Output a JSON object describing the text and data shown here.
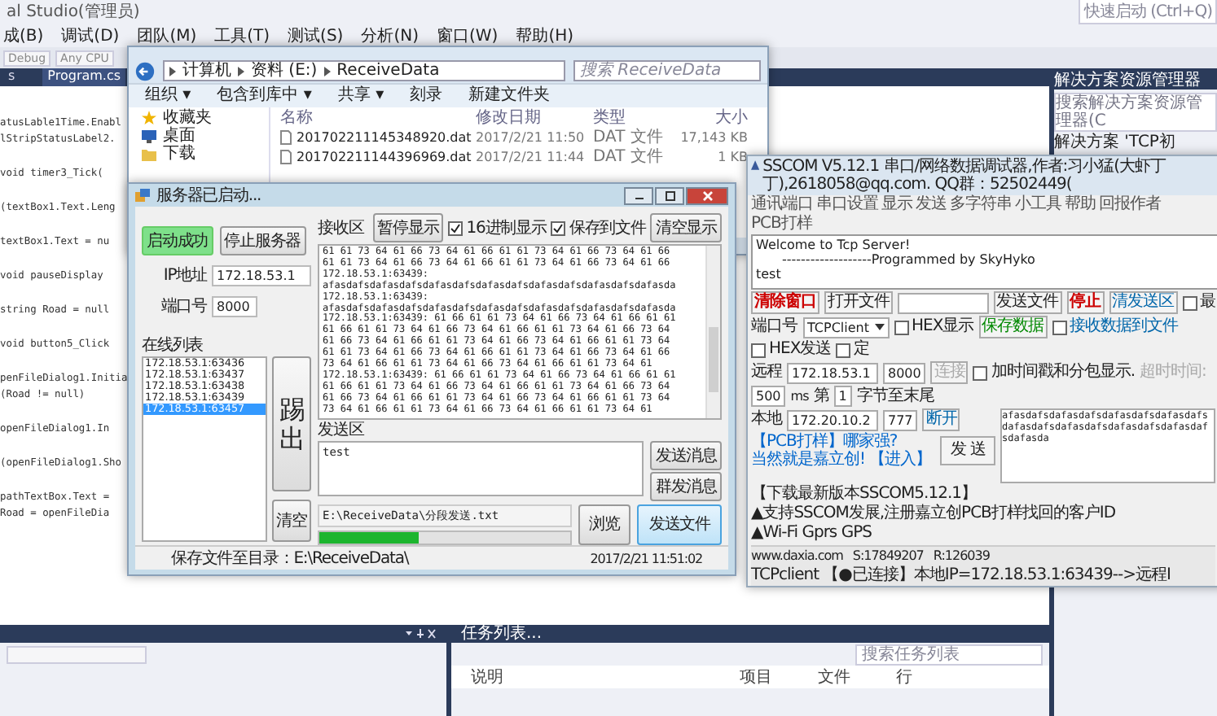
{
  "ide": {
    "title": "al Studio(管理员)",
    "menu": [
      "成(B)",
      "调试(D)",
      "团队(M)",
      "工具(T)",
      "测试(S)",
      "分析(N)",
      "窗口(W)",
      "帮助(H)"
    ],
    "quick_launch": {
      "placeholder": "快速启动 (Ctrl+Q)"
    },
    "toolbar": {
      "configuration": "Debug",
      "platform": "Any CPU"
    },
    "tabs": [
      {
        "label": "s",
        "selected": false
      },
      {
        "label": "Program.cs",
        "selected": true
      }
    ],
    "code_blocks": [
      [
        "atusLable1Time.Enabl",
        "lStripStatusLabel2."
      ],
      [
        "void timer3_Tick("
      ],
      [
        "(textBox1.Text.Leng"
      ],
      [
        "textBox1.Text = nu"
      ],
      [
        "void pauseDisplay"
      ],
      [
        "string Road = null"
      ],
      [
        "void button5_Click"
      ],
      [
        "penFileDialog1.Initia",
        "(Road != null)"
      ],
      [
        "openFileDialog1.In"
      ],
      [
        "(openFileDialog1.Sho"
      ],
      [
        "pathTextBox.Text =",
        "Road = openFileDia"
      ]
    ],
    "solution_explorer": {
      "title": "解决方案资源管理器",
      "search": {
        "placeholder": "搜索解决方案资源管理器(C"
      },
      "items": [
        "解决方案 'TCP初"
      ]
    },
    "task_list": {
      "title": "任务列表...",
      "search": {
        "placeholder": "搜索任务列表"
      },
      "columns": [
        "说明",
        "项目",
        "文件",
        "行"
      ]
    }
  },
  "explorer": {
    "breadcrumb": [
      "计算机",
      "资料 (E:)",
      "ReceiveData"
    ],
    "search": {
      "placeholder": "搜索 ReceiveData"
    },
    "toolbar": [
      "组织 ▾",
      "包含到库中 ▾",
      "共享 ▾",
      "刻录",
      "新建文件夹"
    ],
    "sidebar": [
      {
        "label": "收藏夹",
        "kind": "star"
      },
      {
        "label": "桌面",
        "kind": "desktop"
      },
      {
        "label": "下载",
        "kind": "folder"
      }
    ],
    "columns": [
      "名称",
      "修改日期",
      "类型",
      "大小"
    ],
    "files": [
      {
        "name": "201702211145348920.dat",
        "modified": "2017/2/21 11:50",
        "type": "DAT 文件",
        "size": "17,143 KB"
      },
      {
        "name": "201702211144396969.dat",
        "modified": "2017/2/21 11:44",
        "type": "DAT 文件",
        "size": "1 KB"
      }
    ]
  },
  "server": {
    "title": "服务器已启动...",
    "start_button": "启动成功",
    "stop_button": "停止服务器",
    "ip": {
      "label": "IP地址",
      "value": "172.18.53.1"
    },
    "port": {
      "label": "端口号",
      "value": "8000"
    },
    "online_label": "在线列表",
    "clients": [
      {
        "label": "172.18.53.1:63436",
        "selected": false
      },
      {
        "label": "172.18.53.1:63437",
        "selected": false
      },
      {
        "label": "172.18.53.1:63438",
        "selected": false
      },
      {
        "label": "172.18.53.1:63439",
        "selected": false
      },
      {
        "label": "172.18.53.1:63457",
        "selected": true
      }
    ],
    "kick_button": "踢出",
    "clear_button": "清空",
    "receive_label": "接收区",
    "pause_button": "暂停显示",
    "options": [
      {
        "label": "16进制显示",
        "checked": true
      },
      {
        "label": "保存到文件",
        "checked": true
      }
    ],
    "clear_display_button": "清空显示",
    "received": [
      "61 61 73 64 61 66 73 64 61 66 61 61 73 64 61 66 73 64 61 66",
      "61 61 73 64 61 66 73 64 61 66 61 61 73 64 61 66 73 64 61 66",
      "172.18.53.1:63439:",
      "afasdafsdafasdafsdafasdafsdafasdafsdafasdafsdafasdafsdafasda",
      "172.18.53.1:63439:",
      "afasdafsdafasdafsdafasdafsdafasdafsdafasdafsdafasdafsdafasda",
      "172.18.53.1:63439:  61 66 61 61 73 64 61 66 73 64 61 66 61 61",
      "61 66 61 61 73 64 61 66 73 64 61 66 61 61 73 64 61 66 73 64",
      "61 66 73 64 61 66 61 61 73 64 61 66 73 64 61 66 61 61 73 64",
      "61 61 73 64 61 66 73 64 61 66 61 61 73 64 61 66 73 64 61 66",
      "73 64 61 66 61 61 73 64 61 66 73 64 61 66 61 61 73 64 61",
      "172.18.53.1:63439:  61 66 61 61 73 64 61 66 73 64 61 66 61 61",
      "61 66 61 61 73 64 61 66 73 64 61 66 61 61 73 64 61 66 73 64",
      "61 66 73 64 61 66 61 61 73 64 61 66 73 64 61 66 61 61 73 64",
      "73 64 61 66 61 61 73 64 61 66 73 64 61 66 61 61 73 64 61"
    ],
    "send_label": "发送区",
    "send_text": "test",
    "send_button": "发送消息",
    "broadcast_button": "群发消息",
    "file_path": "E:\\ReceiveData\\分段发送.txt",
    "progress": {
      "level": 0.4
    },
    "browse_button": "浏览",
    "send_file_button": "发送文件",
    "status": "保存文件至目录：E:\\ReceiveData\\",
    "time": "2017/2/21 11:51:02"
  },
  "sscom": {
    "title": "SSCOM V5.12.1 串口/网络数据调试器,作者:习小猛(大虾丁丁),2618058@qq.com. QQ群：52502449(",
    "menu": [
      "通讯端口",
      "串口设置",
      "显示",
      "发送",
      "多字符串",
      "小工具",
      "帮助",
      "回报作者",
      "PCB打样"
    ],
    "received": [
      "Welcome to Tcp Server!",
      "-------------------Programmed by SkyHyko",
      "test"
    ],
    "clear_button": "清除窗口",
    "open_file_button": "打开文件",
    "send_file_button": "发送文件",
    "stop_button": "停止",
    "clear_send_button": "清发送区",
    "port_label": "端口号",
    "port_value": "TCPClient",
    "checks": [
      {
        "label": "最",
        "checked": false
      },
      {
        "label": "HEX显示",
        "checked": false
      },
      {
        "label": "接收数据到文件",
        "checked": false
      },
      {
        "label": "HEX发送",
        "checked": false
      },
      {
        "label": "定",
        "checked": false
      },
      {
        "label": "加时间戳和分包显示.",
        "checked": false
      }
    ],
    "save_button": "保存数据",
    "remote_label": "远程",
    "remote_ip": "172.18.53.1",
    "remote_port": "8000",
    "connect_button": {
      "label": "连接",
      "disabled": true
    },
    "timeout_label": {
      "label": "超时时间:",
      "disabled": true
    },
    "timeout_value": "500",
    "ms": "ms",
    "byte_label": "第",
    "byte_value": "1",
    "byte_suffix": "字节至末尾",
    "local_label": "本地",
    "local_ip": "172.20.10.2",
    "local_port": "777",
    "disconnect_button": {
      "label": "断开",
      "disabled": false
    },
    "send_text": "afasdafsdafasdafsdafasdafsdafasdafsdafasdafsdafasdafsdafasdafsdafasdafsdafasda",
    "ad_links": [
      "【PCB打样】哪家强?",
      "当然就是嘉立创! 【进入】"
    ],
    "send_button": "发 送",
    "banner": [
      "【下载最新版本SSCOM5.12.1】",
      "▲支持SSCOM发展,注册嘉立创PCB打样找回的客户ID",
      "▲Wi-Fi Gprs GPS"
    ],
    "status": [
      "www.daxia.com",
      "S:17849207",
      "R:126039",
      "TCPclient 【●已连接】本地IP=172.18.53.1:63439-->远程I"
    ]
  }
}
